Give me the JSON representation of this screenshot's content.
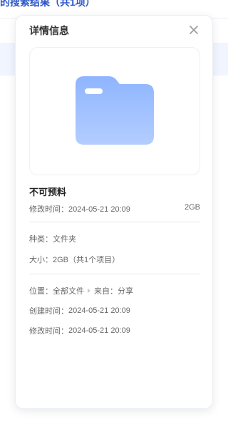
{
  "background": {
    "title": "的搜索结果（共1项）"
  },
  "panel": {
    "title": "详情信息",
    "file_name": "不可预料",
    "modified_label": "修改时间：",
    "modified_value": "2024-05-21 20:09",
    "size_short": "2GB",
    "type_label": "种类：",
    "type_value": "文件夹",
    "size_label": "大小：",
    "size_value": "2GB（共1个项目）",
    "location_label": "位置：",
    "location_value": "全部文件",
    "from_label": "来自：",
    "from_value": "分享",
    "created_label": "创建时间：",
    "created_value": "2024-05-21 20:09",
    "modified2_label": "修改时间：",
    "modified2_value": "2024-05-21 20:09"
  },
  "icons": {
    "close": "close-icon",
    "folder": "folder-icon",
    "separator": "chevron-right-icon"
  },
  "colors": {
    "accent": "#2b55c9",
    "folder_top": "#8fb5ff",
    "folder_bottom": "#b3cdff"
  }
}
